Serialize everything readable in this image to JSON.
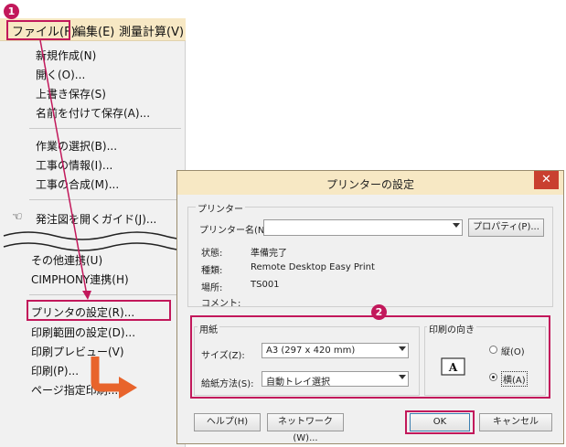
{
  "menubar": {
    "file": "ファイル(F)",
    "edit": "編集(E)",
    "survey": "測量計算(V)"
  },
  "menu": {
    "items": [
      "新規作成(N)",
      "開く(O)...",
      "上書き保存(S)",
      "名前を付けて保存(A)...",
      "作業の選択(B)...",
      "工事の情報(I)...",
      "工事の合成(M)...",
      "発注図を開くガイド(J)...",
      "その他連携(U)",
      "CIMPHONY連携(H)",
      "プリンタの設定(R)...",
      "印刷範囲の設定(D)...",
      "印刷プレビュー(V)",
      "印刷(P)...",
      "ページ指定印刷..."
    ]
  },
  "callouts": {
    "one": "1",
    "two": "2"
  },
  "dialog": {
    "title": "プリンターの設定",
    "close": "✕",
    "printer_group": "プリンター",
    "printer_name_label": "プリンター名(N):",
    "printer_name_value": "",
    "properties_button": "プロパティ(P)...",
    "status_label": "状態:",
    "status_value": "準備完了",
    "type_label": "種類:",
    "type_value": "Remote Desktop Easy Print",
    "location_label": "場所:",
    "location_value": "TS001",
    "comment_label": "コメント:",
    "paper_group": "用紙",
    "size_label": "サイズ(Z):",
    "size_value": "A3 (297 x 420 mm)",
    "source_label": "給紙方法(S):",
    "source_value": "自動トレイ選択",
    "orientation_group": "印刷の向き",
    "portrait_label": "縦(O)",
    "landscape_label": "横(A)",
    "orientation_selected": "landscape",
    "help_button": "ヘルプ(H)",
    "network_button": "ネットワーク(W)...",
    "ok_button": "OK",
    "cancel_button": "キャンセル"
  },
  "colors": {
    "accent": "#c2185b",
    "arrow": "#e8642c",
    "titlebar": "#f7e8c4"
  }
}
